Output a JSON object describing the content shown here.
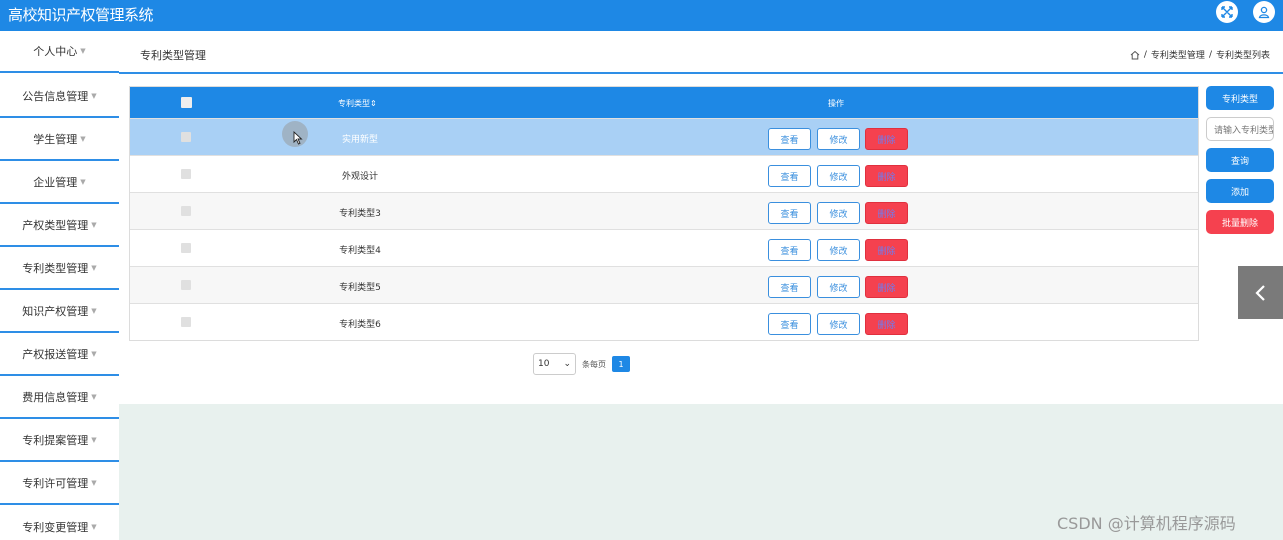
{
  "app": {
    "title": "高校知识产权管理系统"
  },
  "sidebar": {
    "items": [
      {
        "label": "个人中心"
      },
      {
        "label": "公告信息管理"
      },
      {
        "label": "学生管理"
      },
      {
        "label": "企业管理"
      },
      {
        "label": "产权类型管理"
      },
      {
        "label": "专利类型管理"
      },
      {
        "label": "知识产权管理"
      },
      {
        "label": "产权报送管理"
      },
      {
        "label": "费用信息管理"
      },
      {
        "label": "专利提案管理"
      },
      {
        "label": "专利许可管理"
      },
      {
        "label": "专利变更管理"
      }
    ]
  },
  "header": {
    "page_title": "专利类型管理",
    "breadcrumb": [
      "专利类型管理",
      "专利类型列表"
    ]
  },
  "table": {
    "columns": {
      "type": "专利类型",
      "sort_icon": "⇕",
      "operation": "操作"
    },
    "rows": [
      {
        "name": "实用新型"
      },
      {
        "name": "外观设计"
      },
      {
        "name": "专利类型3"
      },
      {
        "name": "专利类型4"
      },
      {
        "name": "专利类型5"
      },
      {
        "name": "专利类型6"
      }
    ],
    "actions": {
      "view": "查看",
      "edit": "修改",
      "delete": "删除"
    }
  },
  "pagination": {
    "page_size": "10",
    "per_page_label": "条每页",
    "current_page": "1"
  },
  "right_panel": {
    "field_label": "专利类型",
    "input_placeholder": "请输入专利类型",
    "search": "查询",
    "add": "添加",
    "batch_delete": "批量删除"
  },
  "watermark": "CSDN @计算机程序源码",
  "colors": {
    "primary": "#1e88e5",
    "danger": "#f5414f",
    "hover_row": "#a9d0f5",
    "content_bg": "#e8f1ee"
  }
}
